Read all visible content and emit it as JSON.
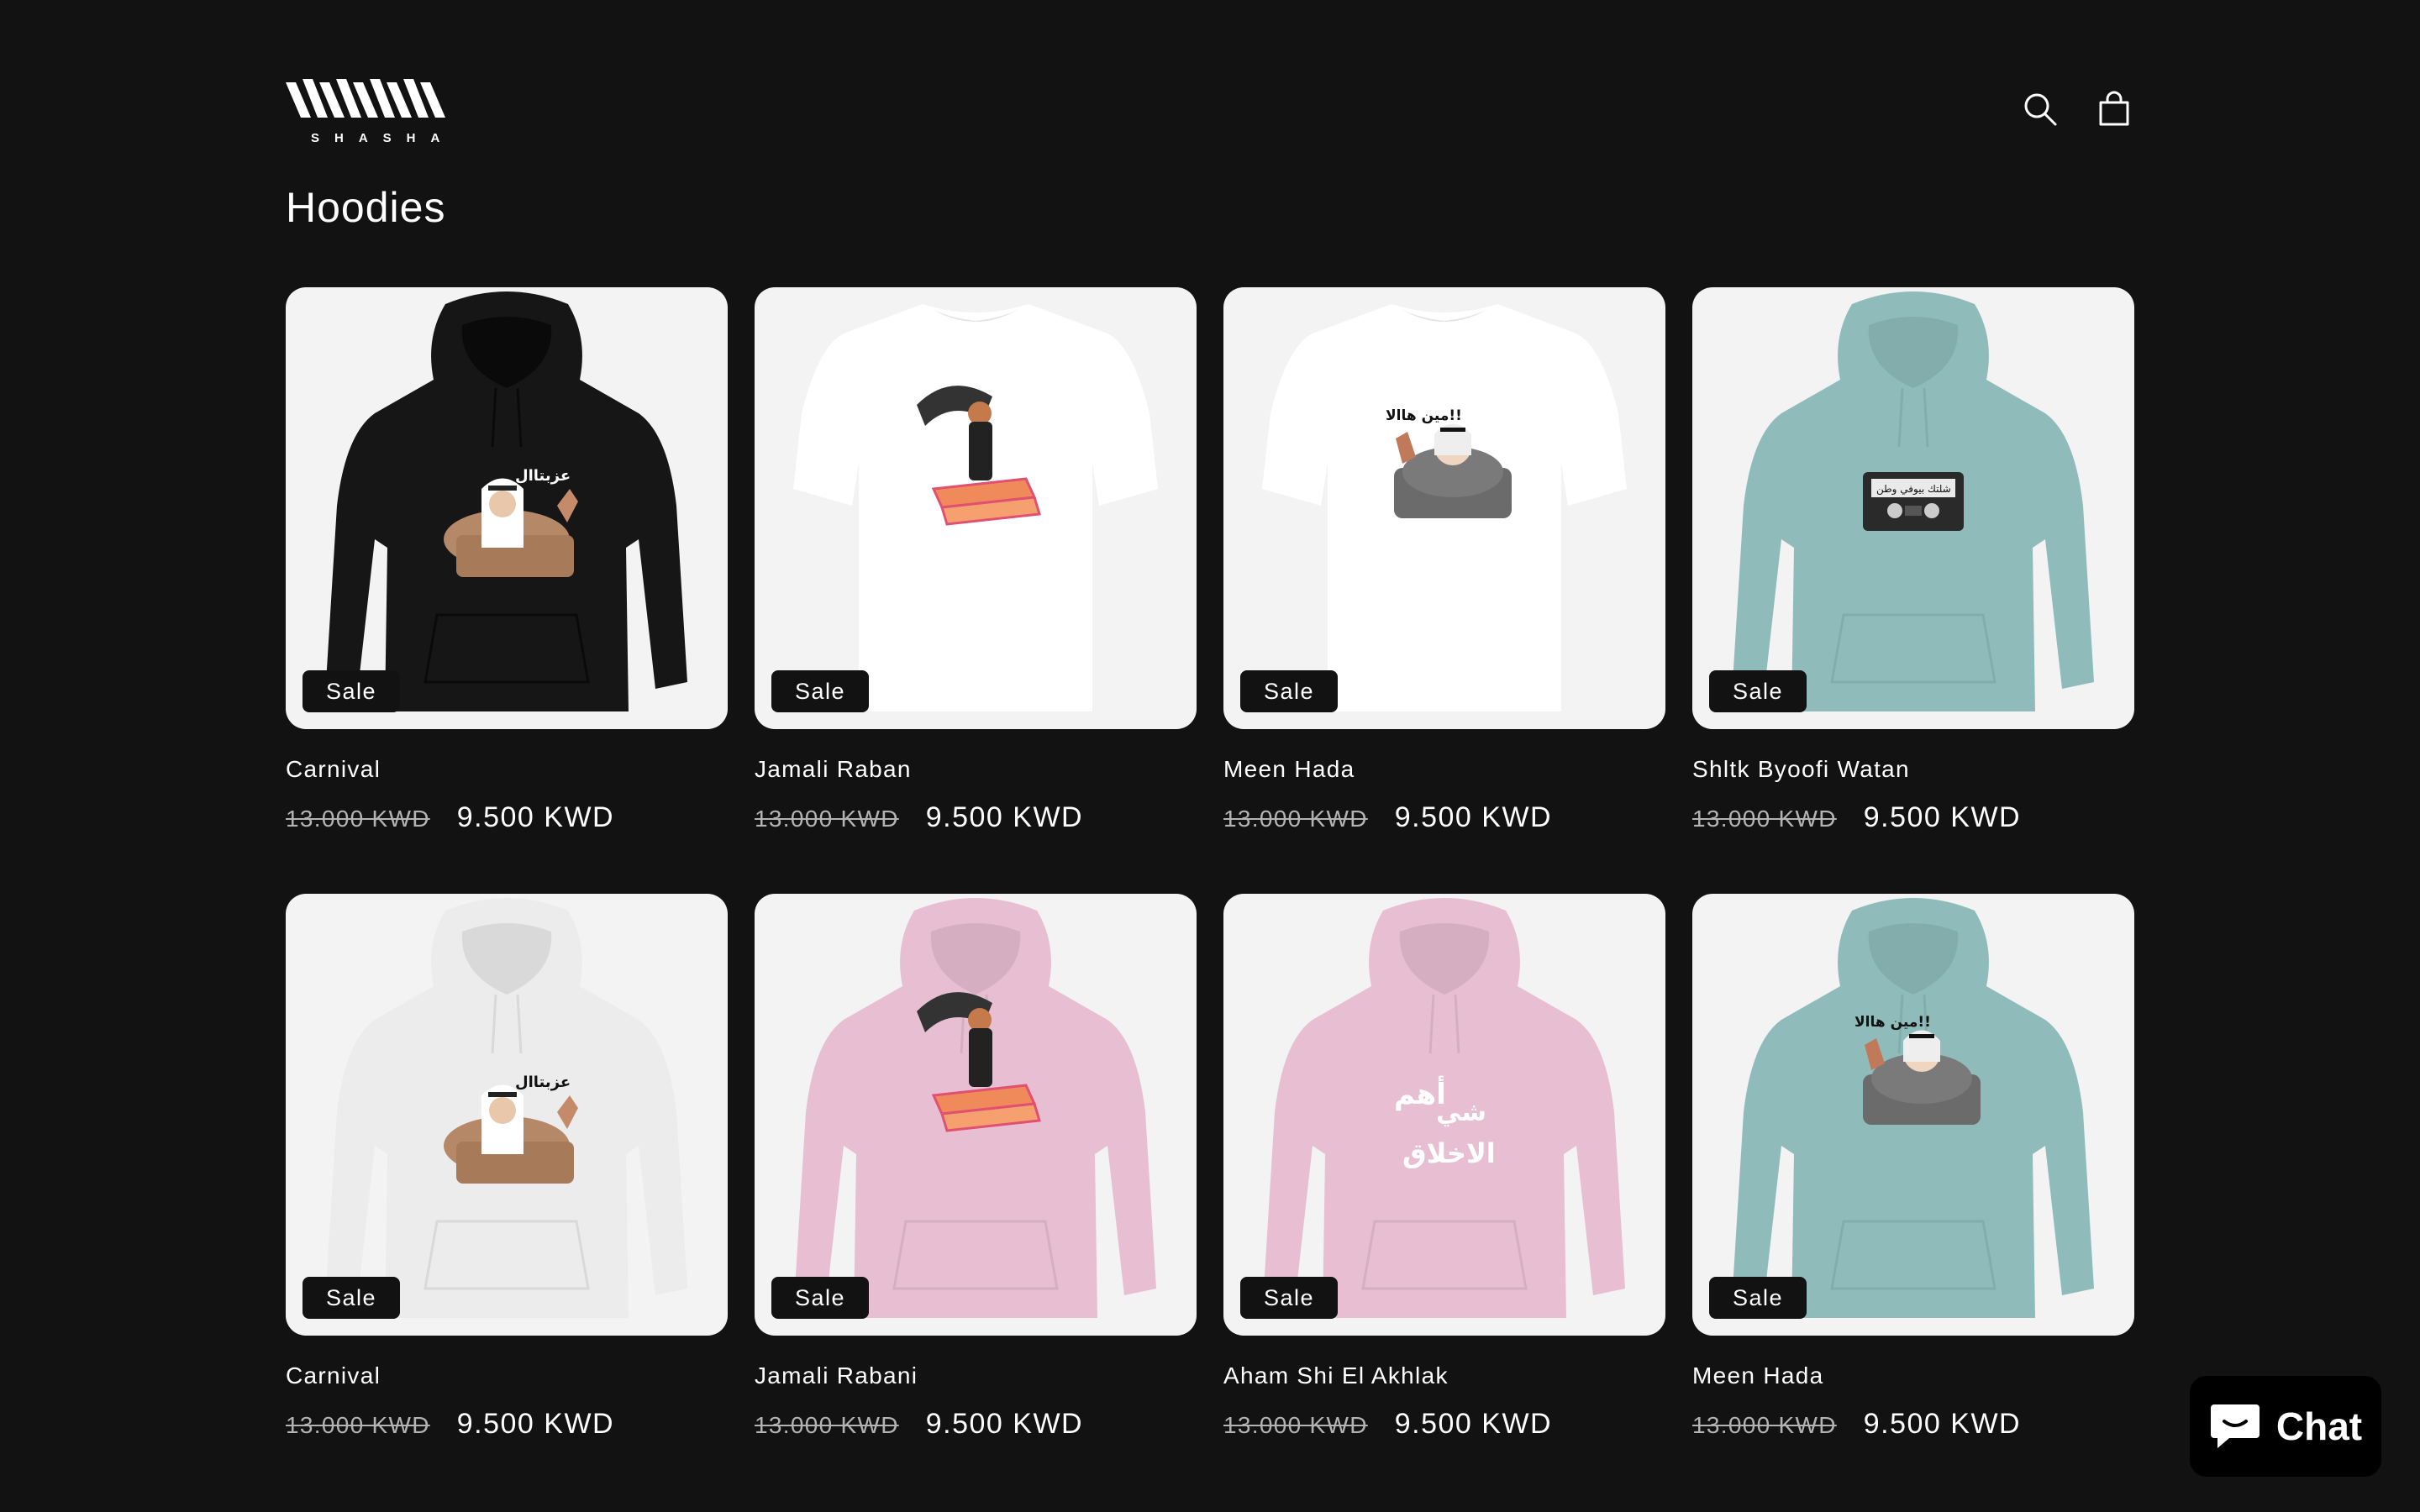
{
  "header": {
    "logo_text": "SHASHA",
    "search_icon": "search-icon",
    "cart_icon": "cart-icon"
  },
  "collection": {
    "title": "Hoodies"
  },
  "products": [
    {
      "title": "Carnival",
      "badge": "Sale",
      "compare_price": "13.000 KWD",
      "price": "9.500 KWD",
      "garment": "hoodie",
      "color": "#161616",
      "print": "man-wave"
    },
    {
      "title": "Jamali Raban",
      "badge": "Sale",
      "compare_price": "13.000 KWD",
      "price": "9.500 KWD",
      "garment": "tshirt",
      "color": "#ffffff",
      "print": "girl-carpet"
    },
    {
      "title": "Meen Hada",
      "badge": "Sale",
      "compare_price": "13.000 KWD",
      "price": "9.500 KWD",
      "garment": "tshirt",
      "color": "#ffffff",
      "print": "man-grey"
    },
    {
      "title": "Shltk Byoofi Watan",
      "badge": "Sale",
      "compare_price": "13.000 KWD",
      "price": "9.500 KWD",
      "garment": "hoodie",
      "color": "#8fbcbb",
      "print": "cassette"
    },
    {
      "title": "Carnival",
      "badge": "Sale",
      "compare_price": "13.000 KWD",
      "price": "9.500 KWD",
      "garment": "hoodie",
      "color": "#ececec",
      "print": "man-wave"
    },
    {
      "title": "Jamali Rabani",
      "badge": "Sale",
      "compare_price": "13.000 KWD",
      "price": "9.500 KWD",
      "garment": "hoodie",
      "color": "#e8bed2",
      "print": "girl-carpet"
    },
    {
      "title": "Aham Shi El Akhlak",
      "badge": "Sale",
      "compare_price": "13.000 KWD",
      "price": "9.500 KWD",
      "garment": "hoodie",
      "color": "#e8bed2",
      "print": "arabic-text"
    },
    {
      "title": "Meen Hada",
      "badge": "Sale",
      "compare_price": "13.000 KWD",
      "price": "9.500 KWD",
      "garment": "hoodie",
      "color": "#8fbcbb",
      "print": "man-grey"
    }
  ],
  "chat": {
    "label": "Chat",
    "icon": "chat-bubble-icon",
    "color": "#000000"
  },
  "colors": {
    "background": "#121212",
    "card_background": "#f3f3f3",
    "text": "#ffffff",
    "muted_text": "#b3b3b3"
  }
}
